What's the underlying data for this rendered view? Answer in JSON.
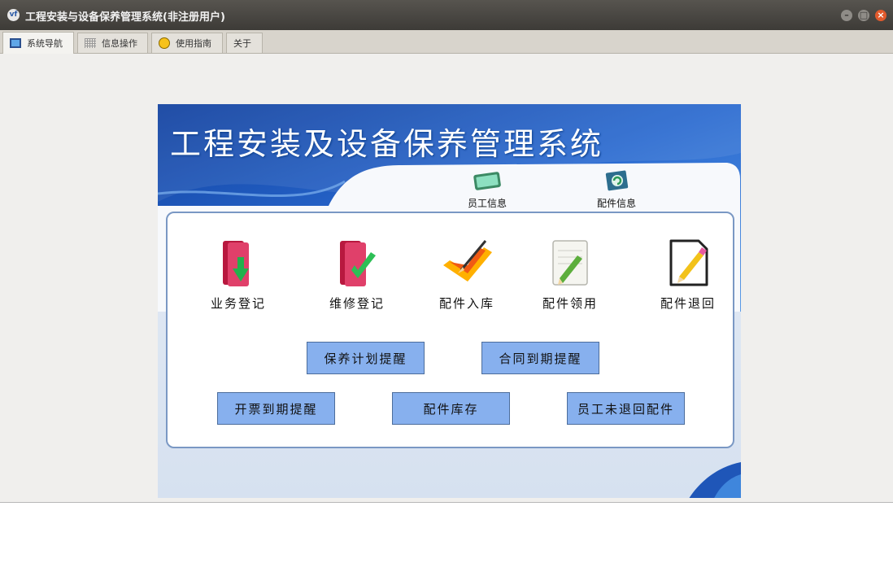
{
  "window": {
    "title": "工程安装与设备保养管理系统(非注册用户)",
    "app_icon": "vf-app-icon"
  },
  "window_controls": {
    "min_icon": "minimize-icon",
    "max_icon": "maximize-icon",
    "close_icon": "close-icon"
  },
  "tabs": [
    {
      "label": "系统导航",
      "icon": "monitor-icon",
      "active": true
    },
    {
      "label": "信息操作",
      "icon": "grid-icon",
      "active": false
    },
    {
      "label": "使用指南",
      "icon": "guide-icon",
      "active": false
    },
    {
      "label": "关于",
      "active": false
    }
  ],
  "banner": {
    "title": "工程安装及设备保养管理系统"
  },
  "quick_links": [
    {
      "label": "员工信息",
      "icon": "monitor-tablet-icon"
    },
    {
      "label": "配件信息",
      "icon": "refresh-monitor-icon"
    }
  ],
  "functions": [
    {
      "label": "业务登记",
      "icon": "red-folder-down-arrow-icon"
    },
    {
      "label": "维修登记",
      "icon": "red-folder-checkmark-icon"
    },
    {
      "label": "配件入库",
      "icon": "orange-pen-icon"
    },
    {
      "label": "配件领用",
      "icon": "notepad-pencil-icon"
    },
    {
      "label": "配件退回",
      "icon": "document-pencil-icon"
    }
  ],
  "buttons": [
    {
      "label": "保养计划提醒"
    },
    {
      "label": "合同到期提醒"
    },
    {
      "label": "开票到期提醒"
    },
    {
      "label": "配件库存"
    },
    {
      "label": "员工未退回配件"
    }
  ],
  "colors": {
    "button_bg": "#87b0ee",
    "banner_blue": "#1f56b8",
    "titlebar": "#4a4843",
    "close_button": "#e25a2c"
  }
}
